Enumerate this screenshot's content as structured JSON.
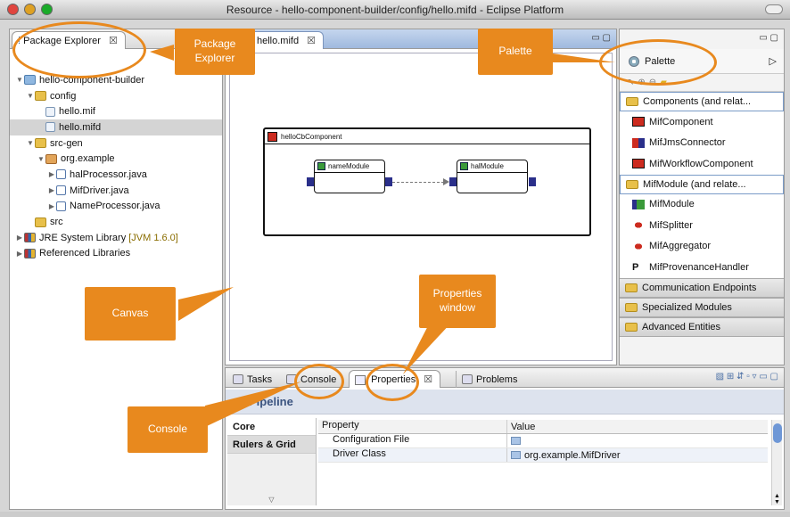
{
  "window": {
    "title": "Resource - hello-component-builder/config/hello.mifd - Eclipse Platform"
  },
  "package_explorer": {
    "tab_label": "Package Explorer",
    "tab_close": "☒",
    "items": [
      {
        "label": "hello-component-builder",
        "twisty": "▼",
        "icon": "project"
      },
      {
        "label": "config",
        "twisty": "▼",
        "icon": "folder"
      },
      {
        "label": "hello.mif",
        "twisty": "",
        "icon": "file"
      },
      {
        "label": "hello.mifd",
        "twisty": "",
        "icon": "file"
      },
      {
        "label": "src-gen",
        "twisty": "▼",
        "icon": "folder"
      },
      {
        "label": "org.example",
        "twisty": "▼",
        "icon": "pkg"
      },
      {
        "label": "halProcessor.java",
        "twisty": "▶",
        "icon": "java"
      },
      {
        "label": "MifDriver.java",
        "twisty": "▶",
        "icon": "java"
      },
      {
        "label": "NameProcessor.java",
        "twisty": "▶",
        "icon": "java"
      },
      {
        "label": "src",
        "twisty": "",
        "icon": "folder"
      },
      {
        "label": "JRE System Library",
        "suffix": "[JVM 1.6.0]",
        "twisty": "▶",
        "icon": "lib"
      },
      {
        "label": "Referenced Libraries",
        "twisty": "▶",
        "icon": "lib"
      }
    ]
  },
  "editor": {
    "tab_label": "hello.mifd",
    "tab_close": "☒",
    "component_name": "helloCbComponent",
    "modules": [
      {
        "name": "nameModule"
      },
      {
        "name": "halModule"
      }
    ]
  },
  "palette": {
    "title": "Palette",
    "collapse_glyph": "▷",
    "drawers": [
      {
        "label": "Components (and relat...",
        "open": true,
        "items": [
          {
            "label": "MifComponent",
            "icon": "component-icon"
          },
          {
            "label": "MifJmsConnector",
            "icon": "connector-icon"
          },
          {
            "label": "MifWorkflowComponent",
            "icon": "component-icon"
          }
        ]
      },
      {
        "label": "MifModule (and relate...",
        "open": true,
        "items": [
          {
            "label": "MifModule",
            "icon": "module-icon"
          },
          {
            "label": "MifSplitter",
            "icon": "splitter-icon"
          },
          {
            "label": "MifAggregator",
            "icon": "aggregator-icon"
          },
          {
            "label": "MifProvenanceHandler",
            "icon": "provenance-icon"
          }
        ]
      },
      {
        "label": "Communication Endpoints",
        "open": false,
        "items": []
      },
      {
        "label": "Specialized Modules",
        "open": false,
        "items": []
      },
      {
        "label": "Advanced Entities",
        "open": false,
        "items": []
      }
    ]
  },
  "bottom_panel": {
    "tabs": [
      {
        "label": "Tasks"
      },
      {
        "label": "Console"
      },
      {
        "label": "Properties",
        "close": "☒"
      },
      {
        "label": "Problems"
      }
    ],
    "properties": {
      "title": "Pipeline",
      "sections": [
        "Core",
        "Rulers & Grid"
      ],
      "columns": [
        "Property",
        "Value"
      ],
      "rows": [
        {
          "property": "Configuration File",
          "value": ""
        },
        {
          "property": "Driver Class",
          "value": "org.example.MifDriver"
        }
      ]
    }
  },
  "annotations": {
    "package_explorer": "Package Explorer",
    "palette": "Palette",
    "canvas": "Canvas",
    "properties": "Properties window",
    "console": "Console"
  },
  "colors": {
    "annotation": "#e8891e",
    "selection": "#d4d4d4",
    "properties_header": "#3b5480"
  }
}
